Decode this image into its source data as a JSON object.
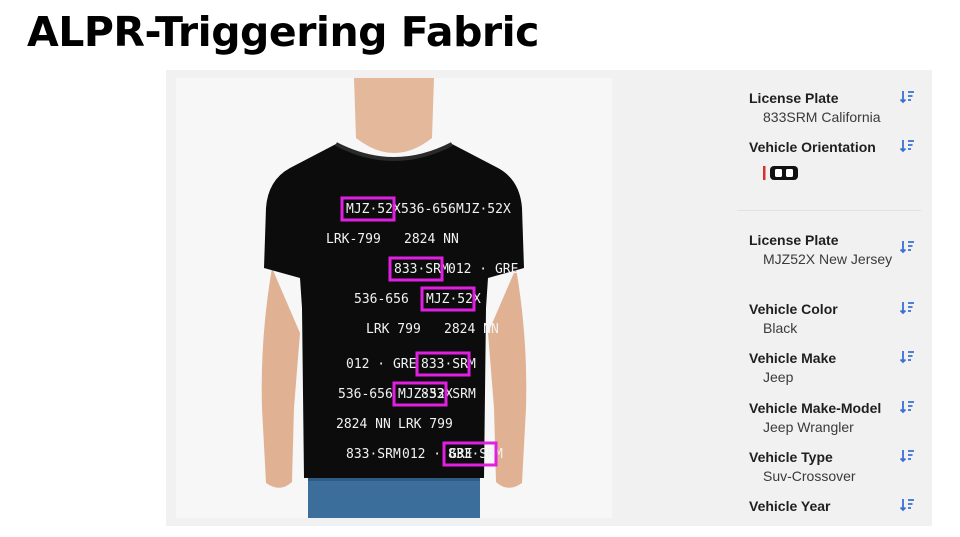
{
  "slide": {
    "title": "ALPR-Triggering Fabric"
  },
  "photo": {
    "alt": "T-shirt printed with license plates",
    "shirt_plates": [
      "MJZ·52X",
      "536-656",
      "MJZ·52X",
      "LRK-799",
      "2824 NN",
      "833·SRM",
      "012 · GRE",
      "536-656",
      "MJZ·52X",
      "LRK 799",
      "2824 NN",
      "833·SRM",
      "012 · GRE",
      "833 SRM",
      "MJZ·52X",
      "536-656",
      "2824 NN",
      "LRK 799",
      "833·SRM",
      "012 · GRE",
      "833·SRM"
    ],
    "highlight_color": "#e01fe0"
  },
  "results": [
    {
      "fields": [
        {
          "label": "License Plate",
          "value": "833SRM   California"
        },
        {
          "label": "Vehicle Orientation",
          "icon": "vehicle-orientation-icon"
        }
      ]
    },
    {
      "fields": [
        {
          "label": "License Plate",
          "value": "MJZ52X   New Jersey"
        },
        {
          "label": "Vehicle Color",
          "value": "Black"
        },
        {
          "label": "Vehicle Make",
          "value": "Jeep"
        },
        {
          "label": "Vehicle Make-Model",
          "value": "Jeep Wrangler"
        },
        {
          "label": "Vehicle Type",
          "value": "Suv-Crossover"
        },
        {
          "label": "Vehicle Year",
          "value": ""
        }
      ]
    }
  ],
  "colors": {
    "sort_icon": "#3a6fd8",
    "orientation_red": "#d9302b"
  }
}
